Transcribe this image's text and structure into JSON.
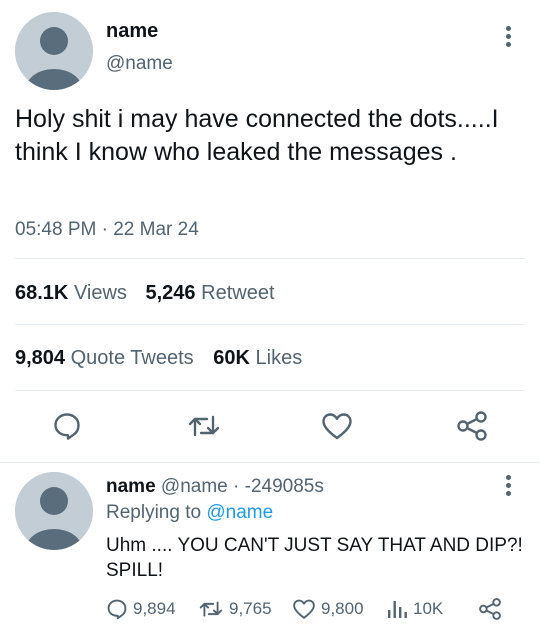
{
  "tweet": {
    "name": "name",
    "handle": "@name",
    "text": "Holy shit i may have connected the dots.....I think I know who leaked the messages .",
    "time": "05:48 PM",
    "separator": "·",
    "date": "22 Mar 24",
    "views_count": "68.1K",
    "views_label": "Views",
    "retweet_count": "5,246",
    "retweet_label": "Retweet",
    "quote_count": "9,804",
    "quote_label": "Quote Tweets",
    "likes_count": "60K",
    "likes_label": "Likes"
  },
  "reply": {
    "name": "name",
    "handle": "@name",
    "separator": "·",
    "time": "-249085s",
    "replying_label": "Replying to",
    "replying_to": "@name",
    "text": "Uhm .... YOU CAN'T JUST SAY THAT AND DIP?! SPILL!",
    "reply_count": "9,894",
    "retweet_count": "9,765",
    "like_count": "9,800",
    "views_count": "10K"
  },
  "colors": {
    "accent": "#1d9bf0",
    "secondary_text": "#536471",
    "avatar_bg": "#c3cdd5",
    "avatar_fg": "#5a6d7c"
  },
  "icons": [
    "more-icon",
    "reply-icon",
    "retweet-icon",
    "like-icon",
    "share-icon",
    "views-icon"
  ]
}
